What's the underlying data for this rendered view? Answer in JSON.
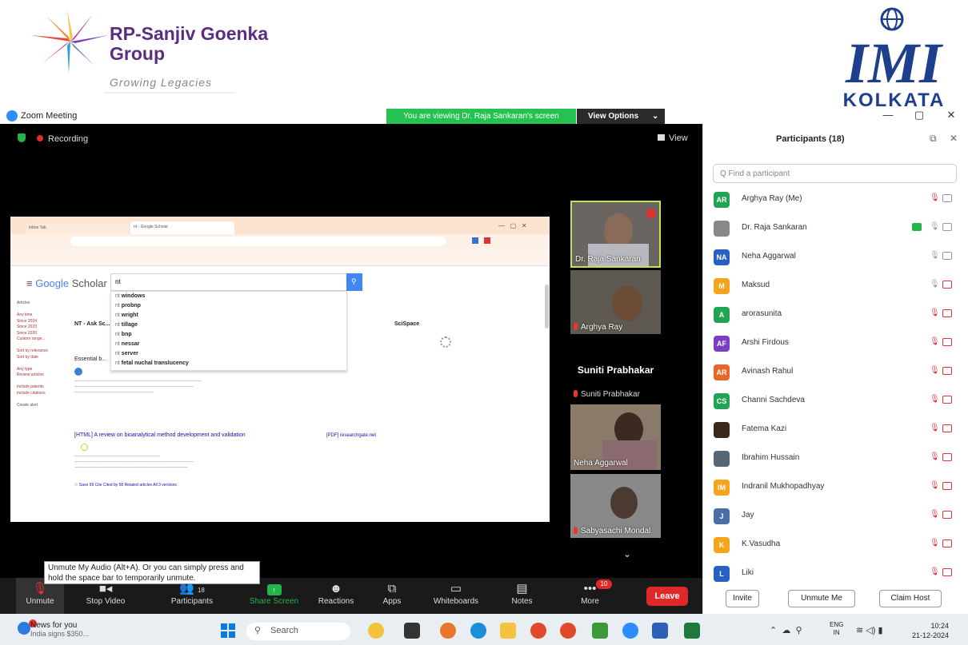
{
  "banner": {
    "rp_name": "RP-Sanjiv Goenka",
    "rp_group": "Group",
    "rp_tagline": "Growing Legacies",
    "imi_logo": "IMI",
    "imi_city": "KOLKATA"
  },
  "window": {
    "title": "Zoom Meeting",
    "viewing_banner": "You are viewing Dr. Raja Sankaran's screen",
    "view_options": "View Options",
    "minimize": "—",
    "restore": "▢",
    "close": "✕"
  },
  "meeting": {
    "recording": "Recording",
    "view": "View"
  },
  "shared_screen": {
    "brand_google": "Google",
    "brand_scholar": "Scholar",
    "search_value": "nt",
    "suggestions": [
      {
        "b": "nt ",
        "t": "windows"
      },
      {
        "b": "nt ",
        "t": "probnp"
      },
      {
        "b": "nt ",
        "t": "wright"
      },
      {
        "b": "nt ",
        "t": "tillage"
      },
      {
        "b": "nt ",
        "t": "bnp"
      },
      {
        "b": "nt ",
        "t": "nessar"
      },
      {
        "b": "nt ",
        "t": "server"
      },
      {
        "b": "nt ",
        "t": "fetal nuchal translucency"
      }
    ],
    "sidebar": [
      "Articles",
      "Any time",
      "Since 2024",
      "Since 2023",
      "Since 2020",
      "Custom range...",
      "Sort by relevance",
      "Sort by date",
      "Any type",
      "Review articles",
      "include patents",
      "include citations",
      "Create alert"
    ],
    "sciSpace": "SciSpace",
    "result1_title": "NT - Ask Sc...",
    "result2_title": "Essential b...",
    "result3_title": "[HTML] A review on bioanalytical method development and validation",
    "result3_source": "[PDF] researchgate.net",
    "result_actions": "☆ Save  99 Cite  Cited by 58  Related articles  All 3 versions",
    "tab1": "Inbox Tab",
    "tab2": "nt - Google Scholar"
  },
  "videos": [
    {
      "name": "Dr. Raja Sankaran"
    },
    {
      "name": "Arghya Ray"
    },
    {
      "name": "Suniti Prabhakar",
      "sub": "Suniti Prabhakar"
    },
    {
      "name": "Neha Aggarwal"
    },
    {
      "name": "Sabyasachi Mondal"
    }
  ],
  "tooltip": "Unmute My Audio (Alt+A). Or you can simply press and hold the space bar to temporarily unmute.",
  "toolbar": {
    "unmute": "Unmute",
    "stop_video": "Stop Video",
    "participants": "Participants",
    "participants_count": "18",
    "share": "Share Screen",
    "reactions": "Reactions",
    "apps": "Apps",
    "whiteboards": "Whiteboards",
    "notes": "Notes",
    "more": "More",
    "more_badge": "10",
    "leave": "Leave"
  },
  "participants_panel": {
    "title": "Participants (18)",
    "search_placeholder": "Q Find a participant",
    "list": [
      {
        "initials": "AR",
        "name": "Arghya Ray (Me)",
        "color": "#23a455"
      },
      {
        "initials": "",
        "name": "Dr. Raja Sankaran",
        "color": "#888"
      },
      {
        "initials": "NA",
        "name": "Neha Aggarwal",
        "color": "#2860c4"
      },
      {
        "initials": "M",
        "name": "Maksud",
        "color": "#f4a51c"
      },
      {
        "initials": "A",
        "name": "arorasunita",
        "color": "#23a455"
      },
      {
        "initials": "AF",
        "name": "Arshi Firdous",
        "color": "#7a3dc4"
      },
      {
        "initials": "AR",
        "name": "Avinash Rahul",
        "color": "#e8662a"
      },
      {
        "initials": "CS",
        "name": "Channi Sachdeva",
        "color": "#23a455"
      },
      {
        "initials": "",
        "name": "Fatema Kazi",
        "color": "#3a2a1a"
      },
      {
        "initials": "",
        "name": "Ibrahim Hussain",
        "color": "#556677"
      },
      {
        "initials": "IM",
        "name": "Indranil Mukhopadhyay",
        "color": "#f4a51c"
      },
      {
        "initials": "J",
        "name": "Jay",
        "color": "#4a6fa5"
      },
      {
        "initials": "K",
        "name": "K.Vasudha",
        "color": "#f4a51c"
      },
      {
        "initials": "L",
        "name": "Liki",
        "color": "#2860c4"
      }
    ],
    "invite": "Invite",
    "unmute_me": "Unmute Me",
    "claim_host": "Claim Host"
  },
  "taskbar": {
    "news_title": "News for you",
    "news_sub": "India signs $350...",
    "search": "Search",
    "lang1": "ENG",
    "lang2": "IN",
    "time": "10:24",
    "date": "21-12-2024"
  }
}
